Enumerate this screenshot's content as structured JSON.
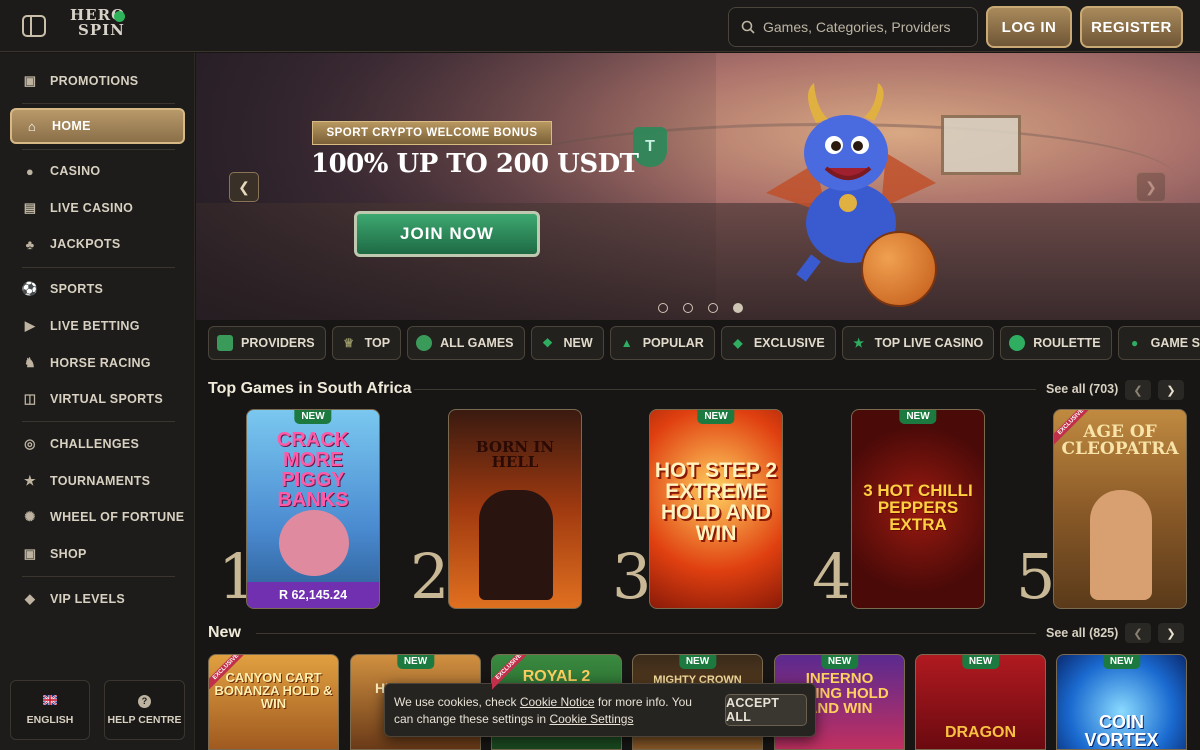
{
  "header": {
    "logo_line1": "HERO",
    "logo_line2": "SPIN",
    "search_placeholder": "Games, Categories, Providers",
    "login_label": "LOG IN",
    "register_label": "REGISTER"
  },
  "sidebar": {
    "items": [
      {
        "label": "PROMOTIONS",
        "icon": "gift-icon"
      },
      {
        "label": "HOME",
        "icon": "home-icon",
        "active": true
      },
      {
        "label": "CASINO",
        "icon": "cherries-icon"
      },
      {
        "label": "LIVE CASINO",
        "icon": "live-cards-icon"
      },
      {
        "label": "JACKPOTS",
        "icon": "clover-icon"
      },
      {
        "label": "SPORTS",
        "icon": "soccer-ball-icon"
      },
      {
        "label": "LIVE BETTING",
        "icon": "live-play-icon"
      },
      {
        "label": "HORSE RACING",
        "icon": "horse-icon"
      },
      {
        "label": "VIRTUAL SPORTS",
        "icon": "gamepad-icon"
      },
      {
        "label": "CHALLENGES",
        "icon": "target-icon"
      },
      {
        "label": "TOURNAMENTS",
        "icon": "trophy-icon"
      },
      {
        "label": "WHEEL OF FORTUNE",
        "icon": "wheel-icon"
      },
      {
        "label": "SHOP",
        "icon": "shopping-bag-icon"
      },
      {
        "label": "VIP LEVELS",
        "icon": "diamond-icon"
      }
    ],
    "language_label": "ENGLISH",
    "help_label": "HELP CENTRE"
  },
  "hero": {
    "ribbon": "SPORT CRYPTO WELCOME BONUS",
    "title": "100% UP TO 200 USDT",
    "cta": "JOIN NOW",
    "slides_total": 4,
    "slide_active": 4
  },
  "categories": [
    {
      "label": "PROVIDERS",
      "icon": "providers-icon",
      "color": "#3a9a5a"
    },
    {
      "label": "TOP",
      "icon": "crown-icon",
      "color": "#9a9a6a"
    },
    {
      "label": "ALL GAMES",
      "icon": "all-games-icon",
      "color": "#3a9a5a"
    },
    {
      "label": "NEW",
      "icon": "new-icon",
      "color": "#2fae62"
    },
    {
      "label": "POPULAR",
      "icon": "flame-icon",
      "color": "#2fae62"
    },
    {
      "label": "EXCLUSIVE",
      "icon": "exclusive-icon",
      "color": "#2fae62"
    },
    {
      "label": "TOP LIVE CASINO",
      "icon": "star-icon",
      "color": "#2fae62"
    },
    {
      "label": "ROULETTE",
      "icon": "roulette-icon",
      "color": "#2fae62"
    },
    {
      "label": "GAME SHOWS",
      "icon": "microphone-icon",
      "color": "#2fae62"
    }
  ],
  "top_games": {
    "title": "Top Games in South Africa",
    "see_all": "See all (703)",
    "games": [
      {
        "rank": "1",
        "name": "CRACK MORE PIGGY BANKS",
        "badge": "NEW",
        "price": "R 62,145.24"
      },
      {
        "rank": "2",
        "name": "BORN IN HELL",
        "badge": ""
      },
      {
        "rank": "3",
        "name": "HOT STEP 2 EXTREME HOLD AND WIN",
        "badge": "NEW"
      },
      {
        "rank": "4",
        "name": "3 HOT CHILLI PEPPERS EXTRA",
        "badge": "NEW"
      },
      {
        "rank": "5",
        "name": "AGE OF CLEOPATRA",
        "badge": "EXCLUSIVE"
      }
    ]
  },
  "new_games": {
    "title": "New",
    "see_all": "See all (825)",
    "games": [
      {
        "name": "CANYON CART BONANZA HOLD & WIN",
        "badge": "EXCLUSIVE"
      },
      {
        "name": "HIGH NOON",
        "badge": "NEW"
      },
      {
        "name": "ROYAL 2",
        "badge": "EXCLUSIVE"
      },
      {
        "name": "MIGHTY CROWN",
        "badge": "NEW"
      },
      {
        "name": "INFERNO RISING HOLD AND WIN",
        "badge": "NEW"
      },
      {
        "name": "DRAGON",
        "badge": "NEW"
      },
      {
        "name": "COIN VORTEX",
        "badge": "NEW"
      }
    ]
  },
  "cookie": {
    "text_before": "We use cookies, check ",
    "notice_link": "Cookie Notice",
    "text_middle": " for more info. You can change these settings in ",
    "settings_link": "Cookie Settings",
    "accept_label": "ACCEPT ALL"
  }
}
